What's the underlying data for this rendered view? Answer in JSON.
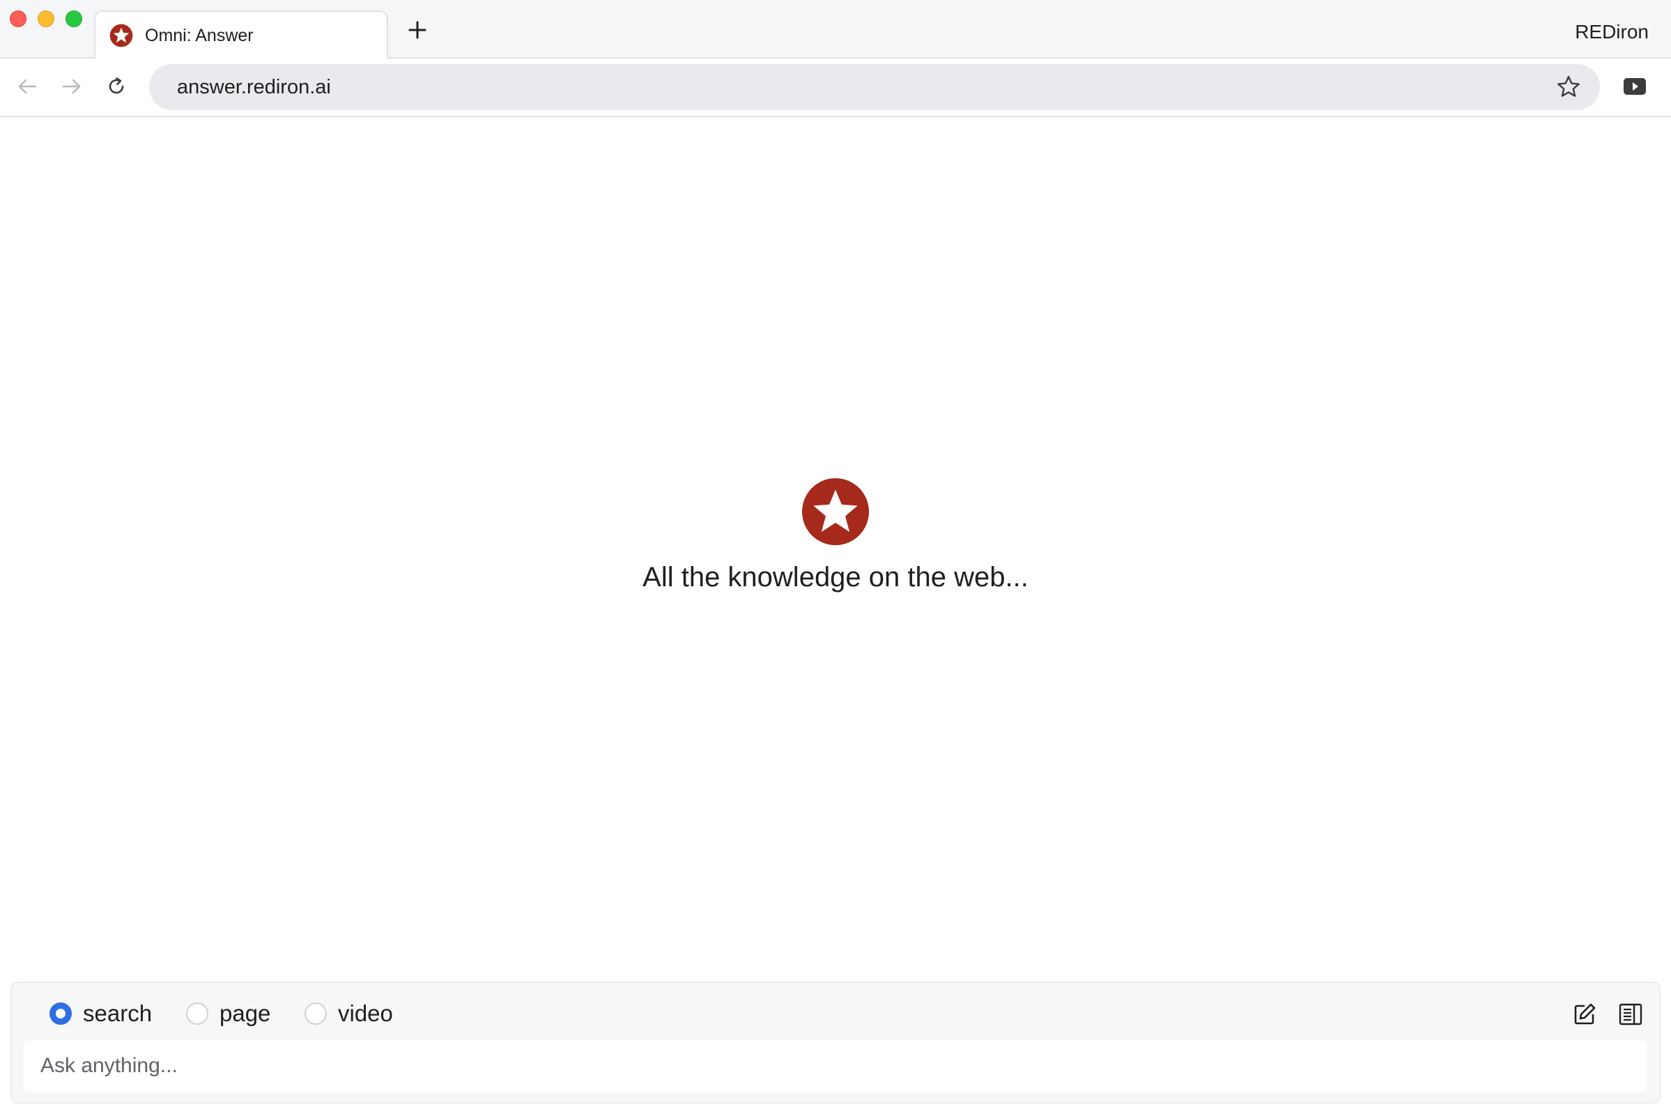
{
  "browser": {
    "tab": {
      "title": "Omni: Answer",
      "favicon": "rediron-logo-icon"
    },
    "new_tab_icon": "plus-icon",
    "profile_name": "REDiron",
    "nav": {
      "back_icon": "arrow-left-icon",
      "forward_icon": "arrow-right-icon",
      "reload_icon": "reload-icon"
    },
    "address": "answer.rediron.ai",
    "bookmark_icon": "star-icon",
    "media_icon": "media-play-icon"
  },
  "hero": {
    "logo": "rediron-logo-icon",
    "tagline": "All the knowledge on the web..."
  },
  "composer": {
    "modes": [
      {
        "label": "search",
        "checked": true
      },
      {
        "label": "page",
        "checked": false
      },
      {
        "label": "video",
        "checked": false
      }
    ],
    "tools": [
      "edit-icon",
      "reader-icon"
    ],
    "input_placeholder": "Ask anything..."
  },
  "colors": {
    "brand": "#a52a1b",
    "radio_accent": "#2f6fe4"
  }
}
